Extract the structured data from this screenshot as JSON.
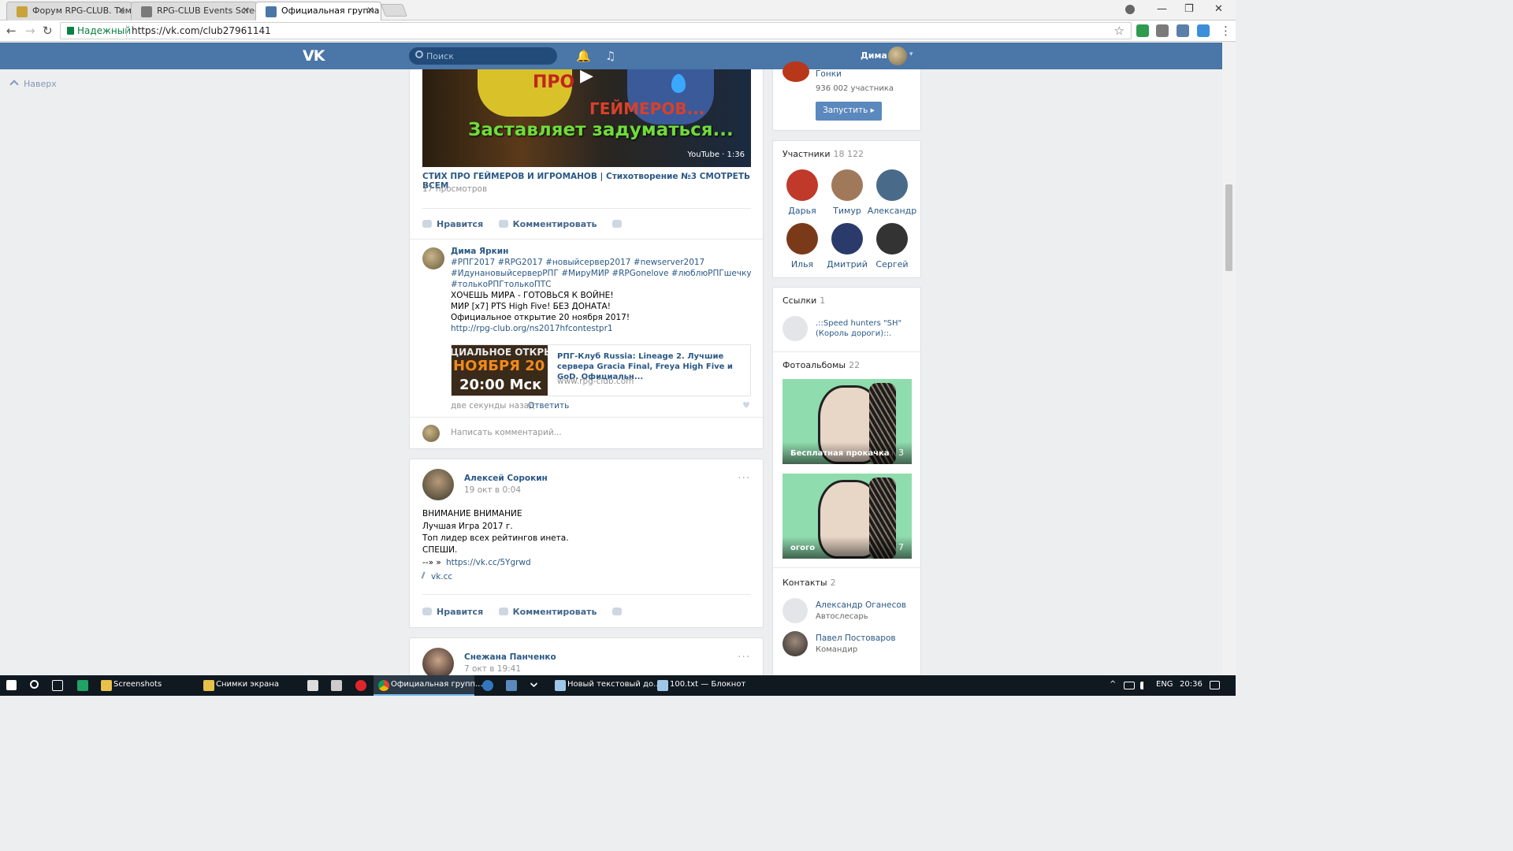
{
  "browser": {
    "tabs": [
      {
        "title": "Форум RPG-CLUB. Тема"
      },
      {
        "title": "RPG-CLUB Events Screen"
      },
      {
        "title": "Официальная группа и"
      }
    ],
    "close_glyph": "✕",
    "window_controls": {
      "minimize": "—",
      "restore": "❐",
      "close": "✕"
    },
    "nav": {
      "back": "←",
      "forward": "→",
      "reload": "↻"
    },
    "address": {
      "secure_label": "Надежный",
      "url": "https://vk.com/club27961141"
    },
    "star": "☆",
    "menu": "⋮"
  },
  "vk_header": {
    "logo": "VK",
    "search_placeholder": "Поиск",
    "bell": "🔔",
    "music": "♫",
    "user_name": "Дима",
    "caret": "▾"
  },
  "scroll_up": "Наверх",
  "video_post": {
    "thumb_caption_top": "ПРО",
    "thumb_caption_mid": "ГЕЙМЕРОВ...",
    "thumb_caption": "Заставляет задуматься...",
    "play": "▶",
    "badge": "YouTube · 1:36",
    "title": "СТИХ ПРО ГЕЙМЕРОВ И ИГРОМАНОВ | Стихотворение №3 СМОТРЕТЬ ВСЕМ",
    "views": "17 просмотров",
    "like": "Нравится",
    "comment": "Комментировать"
  },
  "reply": {
    "author": "Дима Яркин",
    "lines": [
      "#РПГ2017 #RPG2017 #новыйсервер2017 #newserver2017",
      "#ИдунановыйсерверРПГ #МируМИР #RPGonelove #люблюРПГшечку",
      "#толькоРПГтолькоПТС",
      "ХОЧЕШЬ МИРА - ГОТОВЬСЯ К ВОЙНЕ!",
      "МИР [x7] PTS High Five! БЕЗ ДОНАТА!",
      "Официальное открытие 20 ноября 2017!"
    ],
    "link": "http://rpg-club.org/ns2017hfcontestpr1",
    "snippet": {
      "thumb_line1": "ЦИАЛЬНОЕ ОТКРЫ",
      "thumb_line2": "НОЯБРЯ 20",
      "thumb_line3": "20:00 Мск",
      "title": "РПГ-Клуб Russia: Lineage 2. Лучшие сервера Gracia Final, Freya High Five и GoD. Официальн...",
      "domain": "www.rpg-club.com"
    },
    "time": "две секунды назад",
    "answer": "Ответить",
    "heart": "♥",
    "comment_placeholder": "Написать комментарий..."
  },
  "post2": {
    "author": "Алексей Сорокин",
    "date": "19 окт в 0:04",
    "more": "···",
    "lines": [
      "ВНИМАНИЕ ВНИМАНИЕ",
      "Лучшая Игра 2017 г.",
      "Топ лидер всех рейтингов инета.",
      "СПЕШИ."
    ],
    "arrow": "--» »",
    "link": "https://vk.cc/5Ygrwd",
    "attachment": "vk.cc",
    "like": "Нравится",
    "comment": "Комментировать"
  },
  "post3": {
    "author": "Снежана Панченко",
    "date": "7 окт в 19:41",
    "more": "···"
  },
  "sidebar": {
    "app": {
      "name": "Гонки",
      "members": "936 002 участника",
      "button": "Запустить ▸"
    },
    "members": {
      "title": "Участники",
      "count": "18 122",
      "items": [
        {
          "name": "Дарья",
          "color": "#c0392b"
        },
        {
          "name": "Тимур",
          "color": "#a0785a"
        },
        {
          "name": "Александр",
          "color": "#4a6a8a"
        },
        {
          "name": "Илья",
          "color": "#7a3a1a"
        },
        {
          "name": "Дмитрий",
          "color": "#2a3a6a"
        },
        {
          "name": "Сергей",
          "color": "#333333"
        }
      ]
    },
    "links": {
      "title": "Ссылки",
      "count": "1",
      "item_line1": ".::Speed hunters \"SH\"",
      "item_line2": "(Король дороги)::."
    },
    "albums": {
      "title": "Фотоальбомы",
      "count": "22",
      "items": [
        {
          "name": "Бесплатная прокачка все...",
          "count": "3"
        },
        {
          "name": "огого",
          "count": "7"
        }
      ]
    },
    "contacts": {
      "title": "Контакты",
      "count": "2",
      "items": [
        {
          "name": "Александр Оганесов",
          "role": "Автослесарь"
        },
        {
          "name": "Павел Постоваров",
          "role": "Командир"
        }
      ]
    }
  },
  "taskbar": {
    "items": [
      "Screenshots",
      "Снимки экрана",
      "Официальная групп...",
      "Новый текстовый до...",
      "100.txt — Блокнот"
    ],
    "lang": "ENG",
    "time": "20:36",
    "tray_up": "^"
  }
}
